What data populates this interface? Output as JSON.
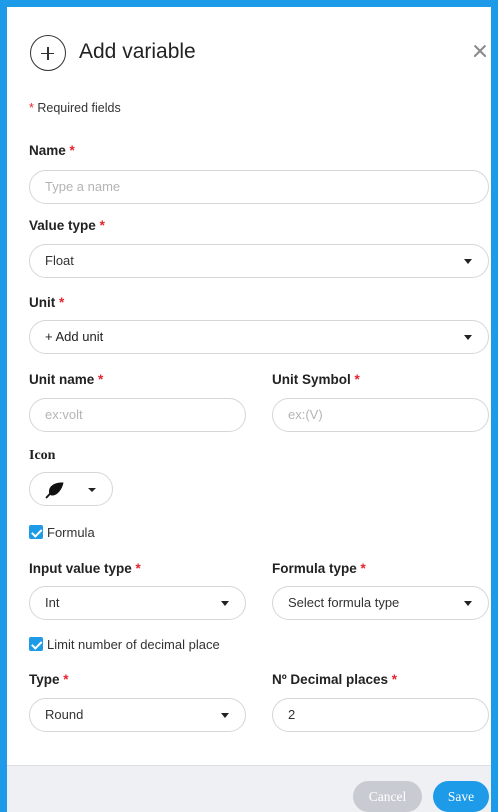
{
  "dialog": {
    "title": "Add variable",
    "required_note": "Required fields",
    "required_star": "*"
  },
  "form": {
    "name": {
      "label": "Name",
      "placeholder": "Type a name",
      "value": ""
    },
    "value_type": {
      "label": "Value type",
      "value": "Float"
    },
    "unit": {
      "label": "Unit",
      "value": "+ Add unit"
    },
    "unit_name": {
      "label": "Unit name",
      "placeholder": "ex:volt",
      "value": ""
    },
    "unit_symbol": {
      "label": "Unit Symbol",
      "placeholder": "ex:(V)",
      "value": ""
    },
    "icon": {
      "label": "Icon",
      "value": "leaf-icon"
    },
    "formula": {
      "label": "Formula",
      "checked": true
    },
    "input_value_type": {
      "label": "Input value type",
      "value": "Int"
    },
    "formula_type": {
      "label": "Formula type",
      "value": "Select formula type"
    },
    "limit_decimal": {
      "label": "Limit number of decimal place",
      "checked": true
    },
    "type": {
      "label": "Type",
      "value": "Round"
    },
    "decimal_places": {
      "label": "Nº Decimal places",
      "value": "2"
    }
  },
  "footer": {
    "cancel_label": "Cancel",
    "save_label": "Save"
  },
  "colors": {
    "accent": "#1e9be8",
    "required_star": "#e3252c",
    "cancel_button": "#c8cbd1"
  }
}
